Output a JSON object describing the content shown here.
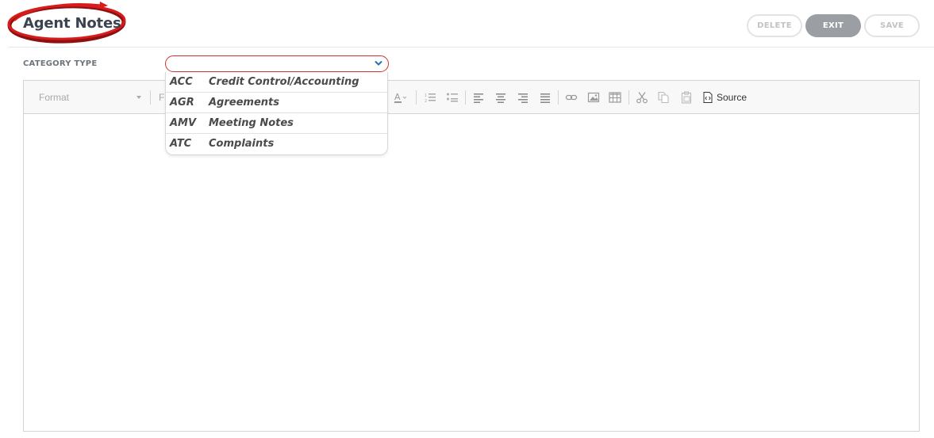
{
  "header": {
    "title": "Agent Notes",
    "buttons": {
      "delete": "DELETE",
      "exit": "EXIT",
      "save": "SAVE"
    }
  },
  "category": {
    "label": "CATEGORY TYPE",
    "selected": "",
    "options": [
      {
        "code": "ACC",
        "name": "Credit Control/Accounting"
      },
      {
        "code": "AGR",
        "name": "Agreements"
      },
      {
        "code": "AMV",
        "name": "Meeting Notes"
      },
      {
        "code": "ATC",
        "name": "Complaints"
      }
    ]
  },
  "editor": {
    "toolbar": {
      "format_placeholder": "Format",
      "font_placeholder": "F",
      "source_label": "Source"
    },
    "content": ""
  },
  "colors": {
    "accent_red": "#d0342c",
    "exit_button": "#9b9fa4",
    "logo_text": "#3b4350"
  }
}
